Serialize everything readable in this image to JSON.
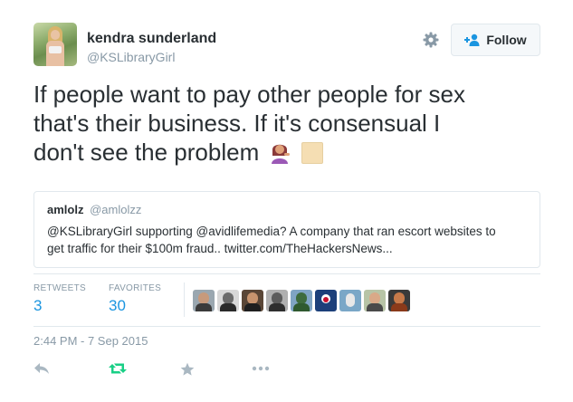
{
  "author": {
    "name": "kendra sunderland",
    "handle": "@KSLibraryGirl"
  },
  "header": {
    "follow_label": "Follow"
  },
  "tweet": {
    "line1": "If people want to pay other people for sex",
    "line2": "that's their business. If it's consensual I",
    "line3": "don't see the problem"
  },
  "quote": {
    "name": "amlolz",
    "handle": "@amlolzz",
    "line1": "@KSLibraryGirl supporting @avidlifemedia? A company that ran escort websites to",
    "line2": "get traffic for their $100m fraud.. twitter.com/TheHackersNews..."
  },
  "stats": {
    "retweets_label": "RETWEETS",
    "retweets_value": "3",
    "favorites_label": "FAVORITES",
    "favorites_value": "30"
  },
  "timestamp": "2:44 PM - 7 Sep 2015",
  "icons": {
    "settings": "gear-icon",
    "follow": "add-user-icon",
    "reply": "reply-icon",
    "retweet": "retweet-icon",
    "favorite": "star-icon",
    "more": "more-icon",
    "emoji1": "woman-tipping-hand-emoji",
    "emoji2": "missing-glyph-box"
  },
  "colors": {
    "accent": "#1b95e0",
    "retweeted": "#19cf86",
    "muted": "#8899a6",
    "text": "#292f33",
    "border": "#e1e8ed"
  }
}
